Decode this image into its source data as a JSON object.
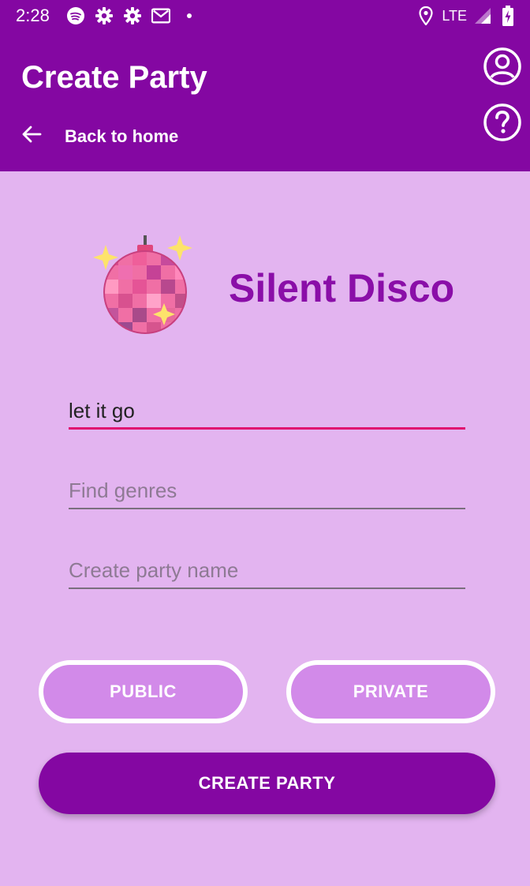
{
  "status_bar": {
    "time": "2:28",
    "network": "LTE",
    "left_icons": [
      "spotify-icon",
      "settings-icon",
      "settings-icon",
      "gmail-icon",
      "dot-icon"
    ],
    "right_icons": [
      "location-icon",
      "signal-icon",
      "battery-charging-icon"
    ]
  },
  "header": {
    "title": "Create Party",
    "back_label": "Back to home",
    "icons": [
      "arrow-back-icon",
      "account-circle-icon",
      "help-circle-icon"
    ]
  },
  "logo": {
    "icon": "disco-ball-icon",
    "text": "Silent Disco"
  },
  "form": {
    "song_value": "let it go",
    "genres_placeholder": "Find genres",
    "party_name_placeholder": "Create party name"
  },
  "buttons": {
    "public": "PUBLIC",
    "private": "PRIVATE",
    "create": "CREATE PARTY"
  },
  "colors": {
    "primary": "#8407a2",
    "background": "#e3b4f0",
    "toggle_fill": "#d28ae9",
    "accent": "#e0116f",
    "brand_text": "#8a0ea8"
  }
}
